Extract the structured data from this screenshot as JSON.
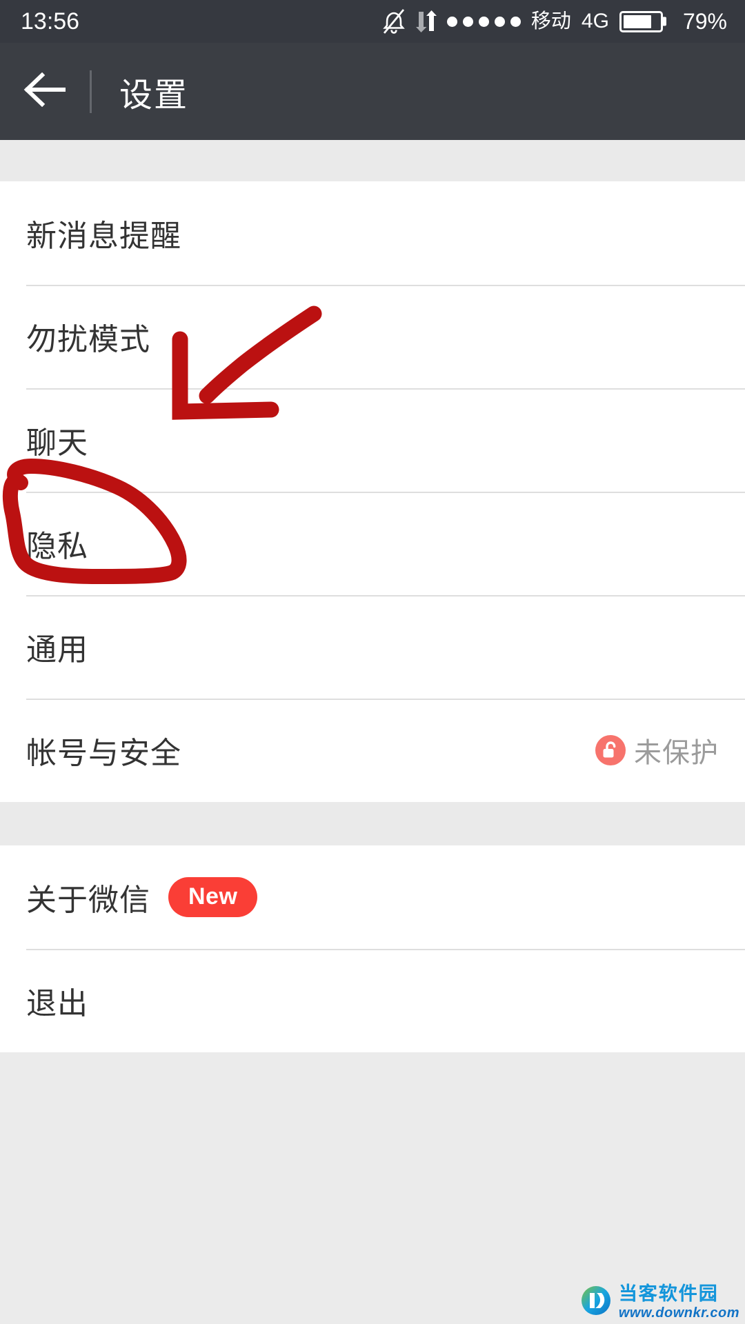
{
  "status_bar": {
    "time": "13:56",
    "icons": [
      "bell-muted-icon",
      "data-transfer-icon"
    ],
    "signal_dots": 5,
    "carrier": "移动",
    "network": "4G",
    "battery_percent": "79%",
    "battery_level": 79
  },
  "app_bar": {
    "back_icon": "arrow-left-icon",
    "title": "设置"
  },
  "groups": [
    {
      "rows": [
        {
          "label": "新消息提醒"
        },
        {
          "label": "勿扰模式"
        },
        {
          "label": "聊天"
        },
        {
          "label": "隐私"
        },
        {
          "label": "通用"
        },
        {
          "label": "帐号与安全",
          "status": "未保护",
          "status_icon": "unlocked-padlock-icon"
        }
      ]
    },
    {
      "rows": [
        {
          "label": "关于微信",
          "badge": "New"
        },
        {
          "label": "退出"
        }
      ]
    }
  ],
  "annotation": {
    "color": "#BB1111",
    "shapes": [
      "circle-around-privacy-row",
      "arrow-pointing-to-privacy"
    ]
  },
  "watermark": {
    "name": "当客软件园",
    "url": "www.downkr.com"
  },
  "colors": {
    "status_bar_bg": "#363940",
    "app_bar_bg": "#3B3E44",
    "page_bg": "#EAEAEA",
    "row_bg": "#FFFFFF",
    "label": "#333333",
    "divider": "#DEDEDE",
    "badge_red": "#FA3E36",
    "lock_salmon": "#F7736C",
    "status_gray": "#9B9B9B",
    "annotation_red": "#BB1111"
  }
}
